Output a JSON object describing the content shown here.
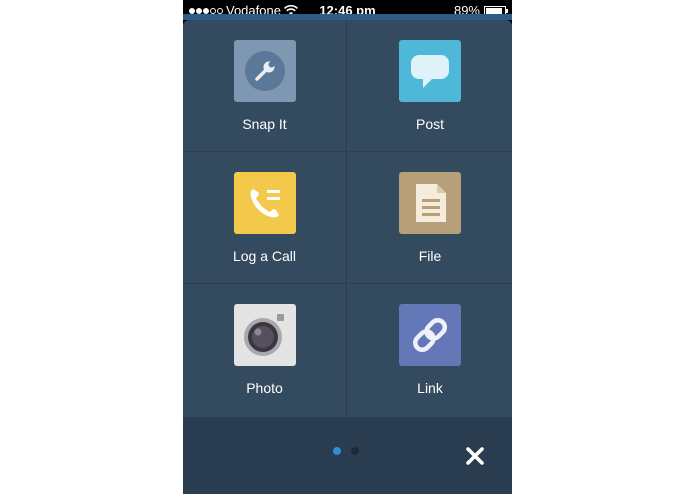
{
  "status_bar": {
    "carrier": "Vodafone",
    "time": "12:46 pm",
    "battery": "89%",
    "battery_level": 0.89
  },
  "actions": [
    {
      "label": "Snap It",
      "icon": "wrench-icon",
      "color": "#7f98b2"
    },
    {
      "label": "Post",
      "icon": "speech-bubble-icon",
      "color": "#4fb8d8"
    },
    {
      "label": "Log a Call",
      "icon": "phone-log-icon",
      "color": "#f3c94c"
    },
    {
      "label": "File",
      "icon": "document-icon",
      "color": "#b7a079"
    },
    {
      "label": "Photo",
      "icon": "camera-icon",
      "color": "#e4e4e4"
    },
    {
      "label": "Link",
      "icon": "chain-link-icon",
      "color": "#6478b8"
    }
  ],
  "pager": {
    "pages": 2,
    "active": 0
  },
  "colors": {
    "panel": "#344a5e",
    "footer": "#2a3c4f",
    "accent": "#2d8fd5"
  }
}
